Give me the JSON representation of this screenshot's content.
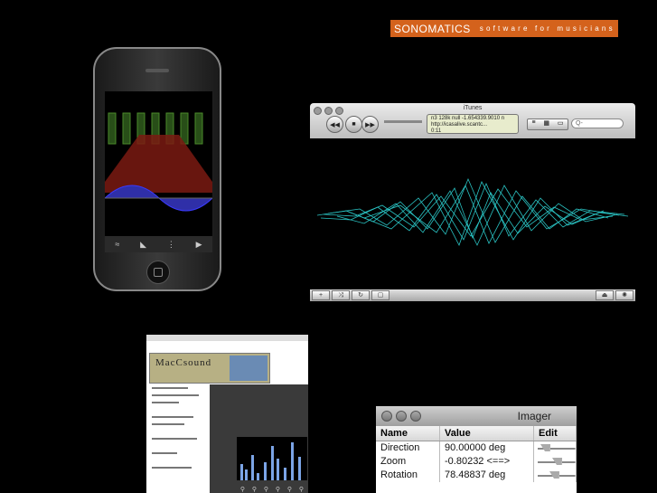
{
  "banner": {
    "brand": "SONOMATICS",
    "tagline": "software for musicians"
  },
  "itunes": {
    "title": "iTunes",
    "lcd_line1": "n3 128k     null  -1.654339.9010 n",
    "lcd_line2": "http://icasalive.scantc...",
    "lcd_line3": "0:11",
    "search_placeholder": "Q-"
  },
  "maccsound": {
    "logo": "MacCsound"
  },
  "imager": {
    "title": "Imager",
    "columns": [
      "Name",
      "Value",
      "Edit"
    ],
    "rows": [
      {
        "name": "Direction",
        "value": "90.00000 deg",
        "edit": 0.1
      },
      {
        "name": "Zoom",
        "value": "-0.80232 <==>",
        "edit": 0.5
      },
      {
        "name": "Rotation",
        "value": "78.48837 deg",
        "edit": 0.4
      }
    ]
  }
}
